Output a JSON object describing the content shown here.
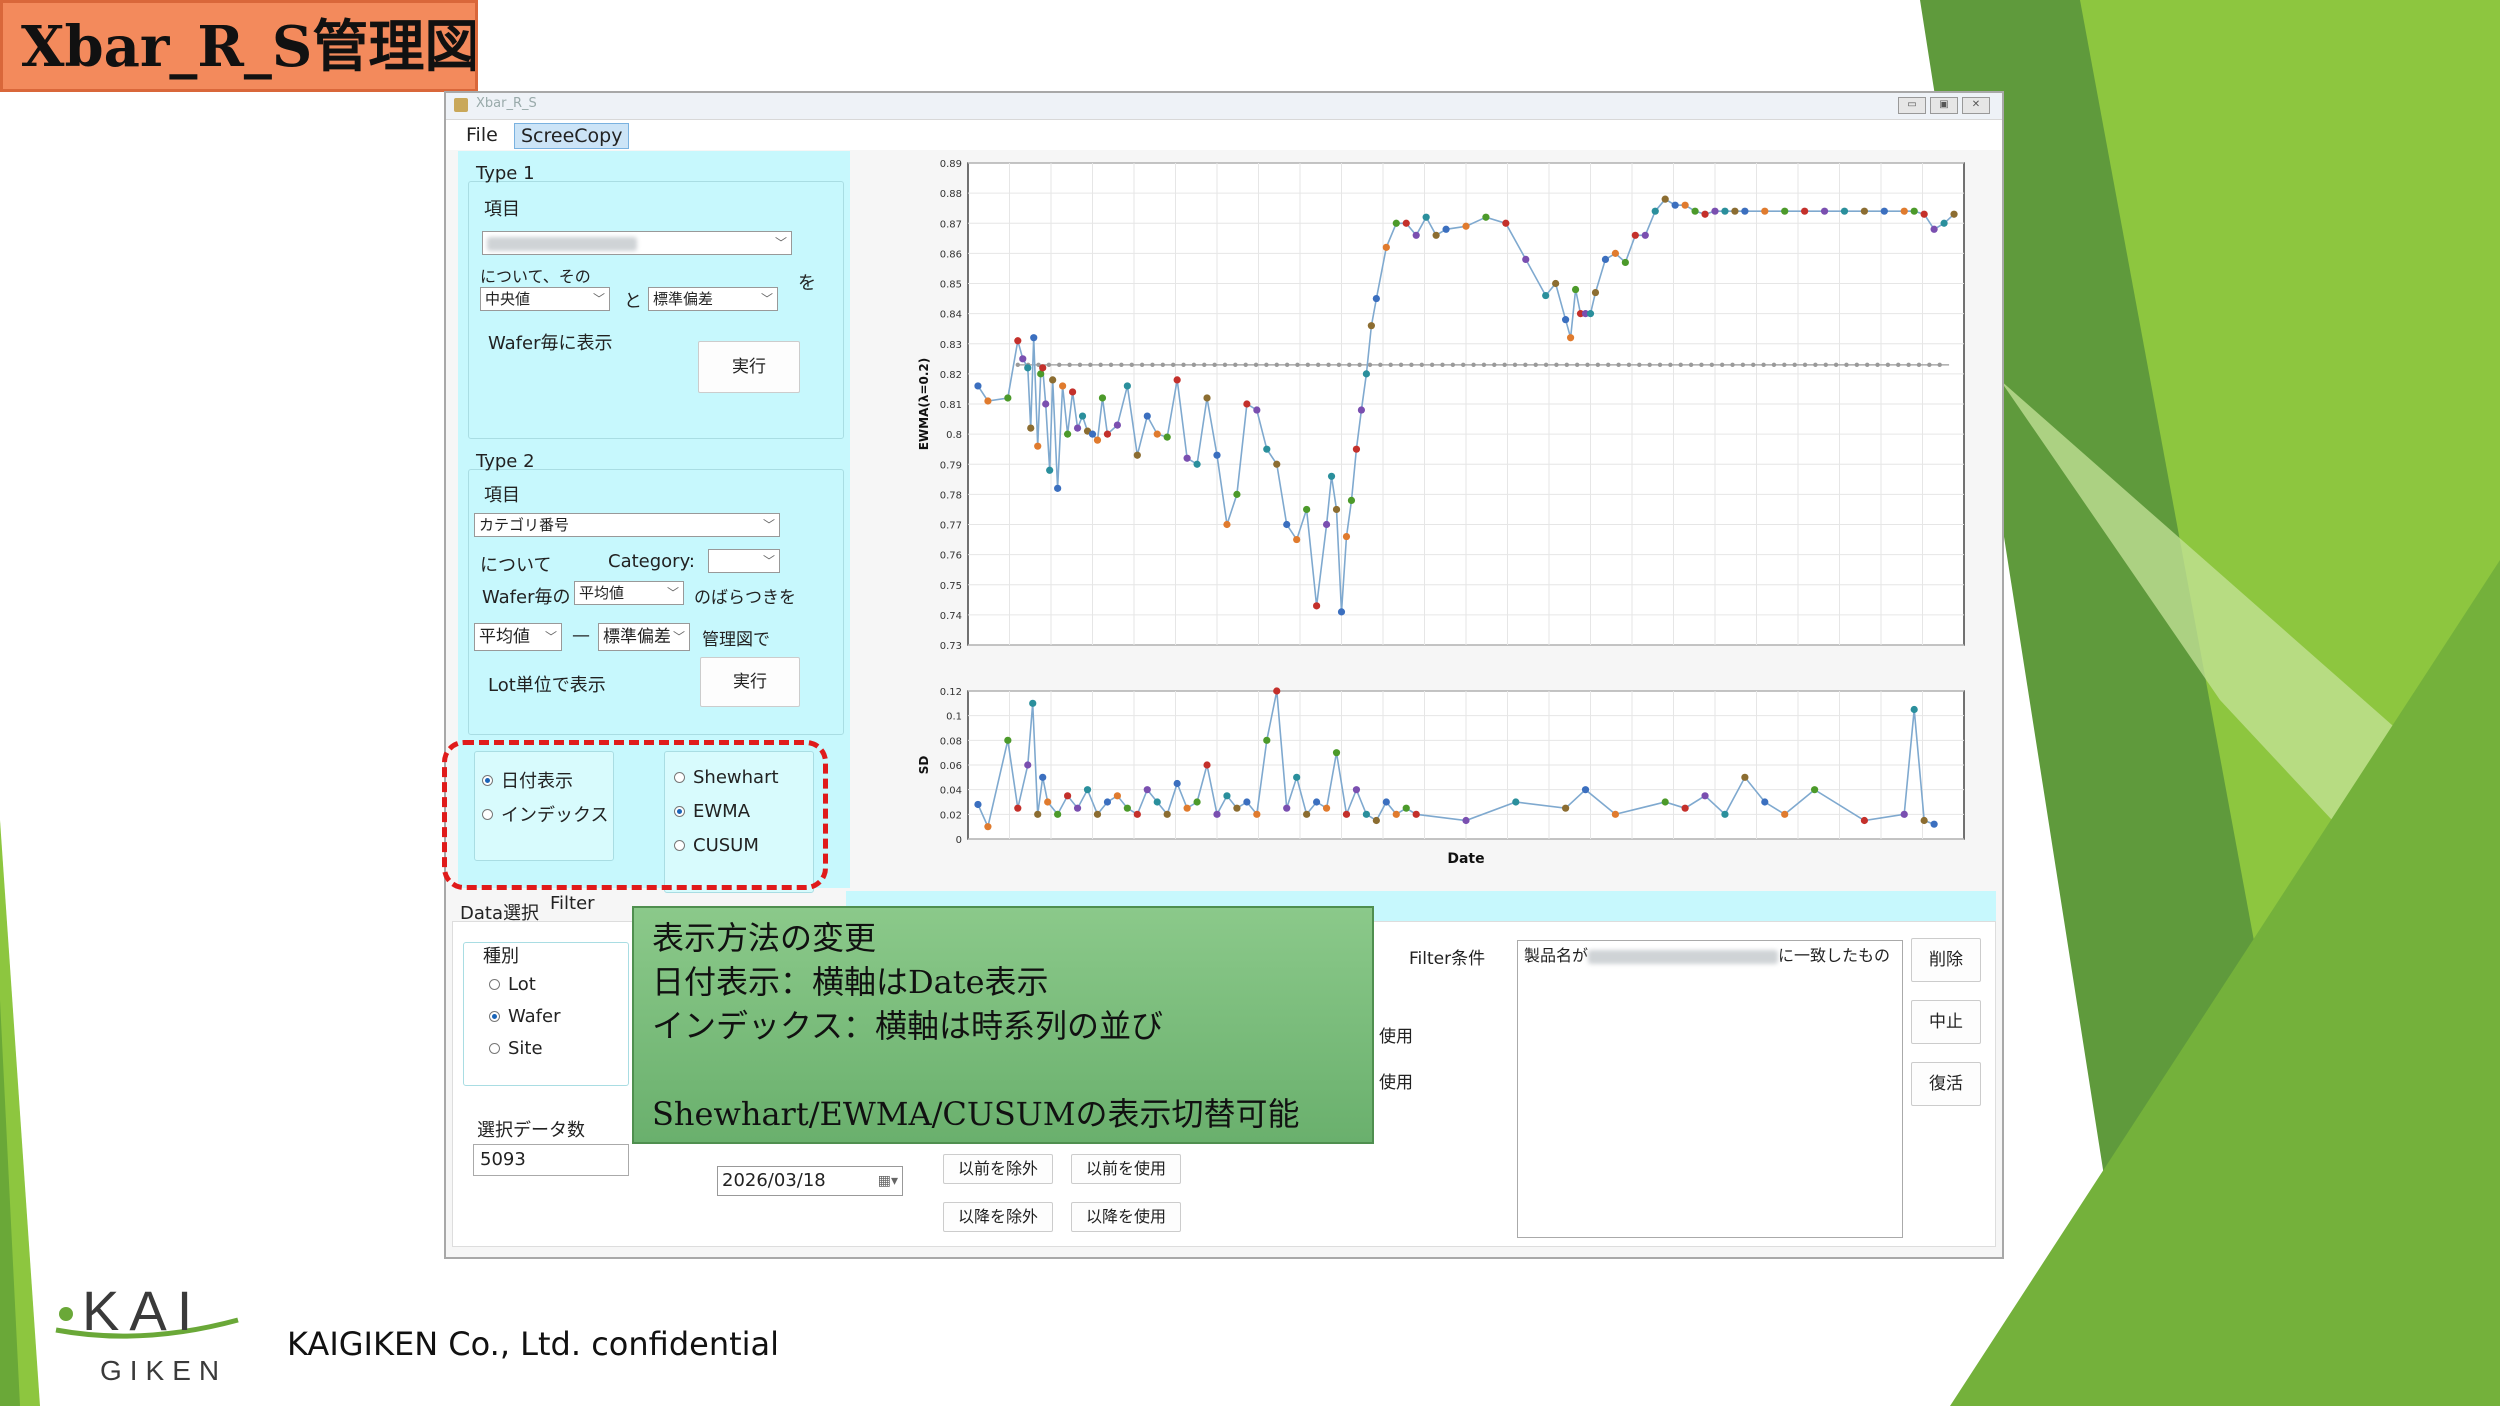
{
  "slide": {
    "title": "Xbar_R_S管理図",
    "footer": "KAIGIKEN Co., Ltd. confidential",
    "logo_top": "KAI",
    "logo_bottom": "GIKEN",
    "colors": {
      "accent_green": "#79b93b",
      "title_fill": "#f38a5c",
      "highlight": "#e01b1b"
    }
  },
  "window": {
    "title": "Xbar_R_S",
    "menu": [
      "File",
      "ScreeCopy"
    ],
    "controls": [
      "▭",
      "▣",
      "✕"
    ]
  },
  "type1": {
    "title": "Type 1",
    "item_label": "項目",
    "about_label": "について、その",
    "combo_a": "中央値",
    "and_label": "と",
    "combo_b": "標準偏差",
    "wo_label": "を",
    "per_wafer_label": "Wafer毎に表示",
    "run_label": "実行"
  },
  "type2": {
    "title": "Type 2",
    "item_label": "項目",
    "item_value": "カテゴリ番号",
    "about_label": "について",
    "category_label": "Category:",
    "wafer_label": "Wafer毎の",
    "wafer_combo": "平均値",
    "spread_label": "のばらつきを",
    "stat_a": "平均値",
    "dash_label": "—",
    "stat_b": "標準偏差",
    "chart_label": "管理図で",
    "lot_label": "Lot単位で表示",
    "run_label": "実行"
  },
  "display_options": {
    "axis_modes": [
      {
        "label": "日付表示",
        "selected": true
      },
      {
        "label": "インデックス",
        "selected": false
      }
    ],
    "chart_types": [
      {
        "label": "Shewhart",
        "selected": false
      },
      {
        "label": "EWMA",
        "selected": true
      },
      {
        "label": "CUSUM",
        "selected": false
      }
    ]
  },
  "tabs": [
    "Data選択",
    "Filter"
  ],
  "filter": {
    "kind_label": "種別",
    "kinds": [
      {
        "label": "Lot",
        "selected": false
      },
      {
        "label": "Wafer",
        "selected": true
      },
      {
        "label": "Site",
        "selected": false
      }
    ],
    "selected_count_label": "選択データ数",
    "selected_count": "5093",
    "date_value": "2026/03/18",
    "use_suffix_1": "使用",
    "use_suffix_2": "使用",
    "btn_exclude_before": "以前を除外",
    "btn_use_before": "以前を使用",
    "btn_exclude_after": "以降を除外",
    "btn_use_after": "以降を使用",
    "condition_label": "Filter条件",
    "condition_prefix": "製品名が",
    "condition_suffix": "に一致したもの",
    "btn_delete": "削除",
    "btn_cancel": "中止",
    "btn_restore": "復活"
  },
  "callout": {
    "line1": "表示方法の変更",
    "line2": "日付表示：横軸はDate表示",
    "line3": "インデックス：横軸は時系列の並び",
    "line4": "Shewhart/EWMA/CUSUMの表示切替可能"
  },
  "chart_data": [
    {
      "type": "line",
      "ylabel": "EWMA(λ=0.2)",
      "xlabel": "",
      "ylim": [
        0.73,
        0.89
      ],
      "yticks": [
        0.73,
        0.74,
        0.75,
        0.76,
        0.77,
        0.78,
        0.79,
        0.8,
        0.81,
        0.82,
        0.83,
        0.84,
        0.85,
        0.86,
        0.87,
        0.88,
        0.89
      ],
      "center_line": 0.823,
      "grid": true,
      "x": [
        0.01,
        0.02,
        0.04,
        0.05,
        0.055,
        0.06,
        0.063,
        0.066,
        0.07,
        0.073,
        0.075,
        0.078,
        0.082,
        0.085,
        0.09,
        0.095,
        0.1,
        0.105,
        0.11,
        0.115,
        0.12,
        0.125,
        0.13,
        0.135,
        0.14,
        0.15,
        0.16,
        0.17,
        0.18,
        0.19,
        0.2,
        0.21,
        0.22,
        0.23,
        0.24,
        0.25,
        0.26,
        0.27,
        0.28,
        0.29,
        0.3,
        0.31,
        0.32,
        0.33,
        0.34,
        0.35,
        0.36,
        0.365,
        0.37,
        0.375,
        0.38,
        0.385,
        0.39,
        0.395,
        0.4,
        0.405,
        0.41,
        0.42,
        0.43,
        0.44,
        0.45,
        0.46,
        0.47,
        0.48,
        0.5,
        0.52,
        0.54,
        0.56,
        0.58,
        0.59,
        0.6,
        0.605,
        0.61,
        0.615,
        0.62,
        0.625,
        0.63,
        0.64,
        0.65,
        0.66,
        0.67,
        0.68,
        0.69,
        0.7,
        0.71,
        0.72,
        0.73,
        0.74,
        0.75,
        0.76,
        0.77,
        0.78,
        0.8,
        0.82,
        0.84,
        0.86,
        0.88,
        0.9,
        0.92,
        0.94,
        0.95,
        0.96,
        0.97,
        0.98,
        0.99
      ],
      "values": [
        0.816,
        0.811,
        0.812,
        0.831,
        0.825,
        0.822,
        0.802,
        0.832,
        0.796,
        0.82,
        0.822,
        0.81,
        0.788,
        0.818,
        0.782,
        0.816,
        0.8,
        0.814,
        0.802,
        0.806,
        0.801,
        0.8,
        0.798,
        0.812,
        0.8,
        0.803,
        0.816,
        0.793,
        0.806,
        0.8,
        0.799,
        0.818,
        0.792,
        0.79,
        0.812,
        0.793,
        0.77,
        0.78,
        0.81,
        0.808,
        0.795,
        0.79,
        0.77,
        0.765,
        0.775,
        0.743,
        0.77,
        0.786,
        0.775,
        0.741,
        0.766,
        0.778,
        0.795,
        0.808,
        0.82,
        0.836,
        0.845,
        0.862,
        0.87,
        0.87,
        0.866,
        0.872,
        0.866,
        0.868,
        0.869,
        0.872,
        0.87,
        0.858,
        0.846,
        0.85,
        0.838,
        0.832,
        0.848,
        0.84,
        0.84,
        0.84,
        0.847,
        0.858,
        0.86,
        0.857,
        0.866,
        0.866,
        0.874,
        0.878,
        0.876,
        0.876,
        0.874,
        0.873,
        0.874,
        0.874,
        0.874,
        0.874,
        0.874,
        0.874,
        0.874,
        0.874,
        0.874,
        0.874,
        0.874,
        0.874,
        0.874,
        0.873,
        0.868,
        0.87,
        0.873
      ]
    },
    {
      "type": "line",
      "ylabel": "SD",
      "xlabel": "Date",
      "ylim": [
        0,
        0.12
      ],
      "yticks": [
        0,
        0.02,
        0.04,
        0.06,
        0.08,
        0.1,
        0.12
      ],
      "grid": true,
      "x": [
        0.01,
        0.02,
        0.04,
        0.05,
        0.06,
        0.065,
        0.07,
        0.075,
        0.08,
        0.09,
        0.1,
        0.11,
        0.12,
        0.13,
        0.14,
        0.15,
        0.16,
        0.17,
        0.18,
        0.19,
        0.2,
        0.21,
        0.22,
        0.23,
        0.24,
        0.25,
        0.26,
        0.27,
        0.28,
        0.29,
        0.3,
        0.31,
        0.32,
        0.33,
        0.34,
        0.35,
        0.36,
        0.37,
        0.38,
        0.39,
        0.4,
        0.41,
        0.42,
        0.43,
        0.44,
        0.45,
        0.5,
        0.55,
        0.6,
        0.62,
        0.65,
        0.7,
        0.72,
        0.74,
        0.76,
        0.78,
        0.8,
        0.82,
        0.85,
        0.9,
        0.94,
        0.95,
        0.96,
        0.97
      ],
      "values": [
        0.028,
        0.01,
        0.08,
        0.025,
        0.06,
        0.11,
        0.02,
        0.05,
        0.03,
        0.02,
        0.035,
        0.025,
        0.04,
        0.02,
        0.03,
        0.035,
        0.025,
        0.02,
        0.04,
        0.03,
        0.02,
        0.045,
        0.025,
        0.03,
        0.06,
        0.02,
        0.035,
        0.025,
        0.03,
        0.02,
        0.08,
        0.12,
        0.025,
        0.05,
        0.02,
        0.03,
        0.025,
        0.07,
        0.02,
        0.04,
        0.02,
        0.015,
        0.03,
        0.02,
        0.025,
        0.02,
        0.015,
        0.03,
        0.025,
        0.04,
        0.02,
        0.03,
        0.025,
        0.035,
        0.02,
        0.05,
        0.03,
        0.02,
        0.04,
        0.015,
        0.02,
        0.105,
        0.015,
        0.012
      ]
    }
  ]
}
